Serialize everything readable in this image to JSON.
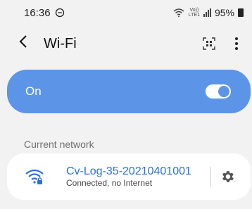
{
  "status_bar": {
    "time": "16:36",
    "dnd_icon": "do-not-disturb-icon",
    "volte": "Vo))\nLTE1",
    "battery_percent": "95%",
    "battery_level": 0.95
  },
  "appbar": {
    "back_glyph": "<",
    "title": "Wi-Fi",
    "qr_icon": "qr-scan-icon",
    "more_icon": "more-options-icon"
  },
  "wifi_toggle": {
    "label": "On",
    "enabled": true,
    "accent": "#5c95e8"
  },
  "current_network": {
    "section_label": "Current network",
    "name": "Cv-Log-35-20210401001",
    "status": "Connected, no Internet",
    "name_color": "#2a70d8",
    "wifi_icon": "wifi-secured-icon",
    "settings_icon": "gear-icon"
  }
}
